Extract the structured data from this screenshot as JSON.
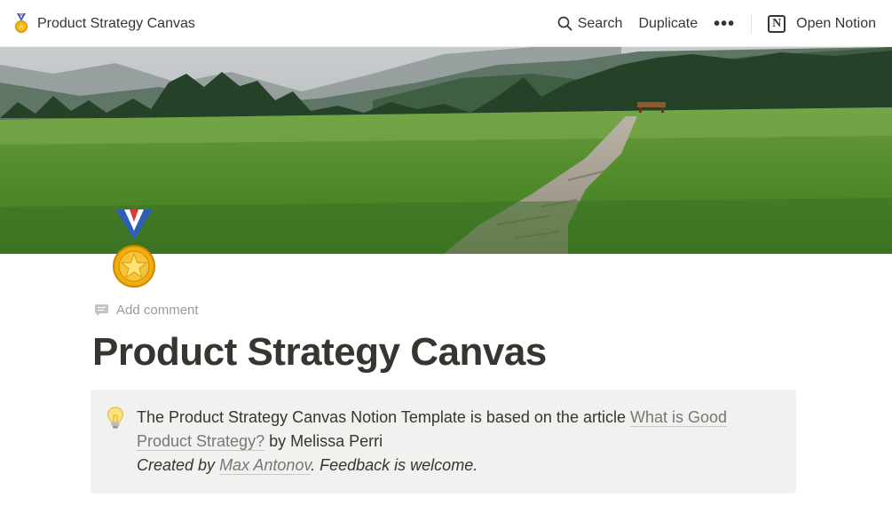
{
  "topbar": {
    "breadcrumb_title": "Product Strategy Canvas",
    "search_label": "Search",
    "duplicate_label": "Duplicate",
    "more_label": "•••",
    "open_notion_label": "Open Notion",
    "notion_logo_letter": "N"
  },
  "icons": {
    "page_icon": "medal-icon",
    "comment": "comment-icon",
    "search": "search-icon",
    "callout": "lightbulb-icon"
  },
  "page": {
    "add_comment": "Add comment",
    "title": "Product Strategy Canvas"
  },
  "callout": {
    "text_before_link": "The Product Strategy Canvas Notion Template is based on the article ",
    "article_link": "What is Good Product Strategy?",
    "text_after_link": " by Melissa Perri",
    "created_by_prefix": "Created by ",
    "author_link": "Max Antonov",
    "created_by_suffix": ". Feedback is welcome."
  },
  "colors": {
    "text": "#37352f",
    "muted": "#9b9a97",
    "callout_bg": "#f1f1ef",
    "link": "#787774"
  }
}
